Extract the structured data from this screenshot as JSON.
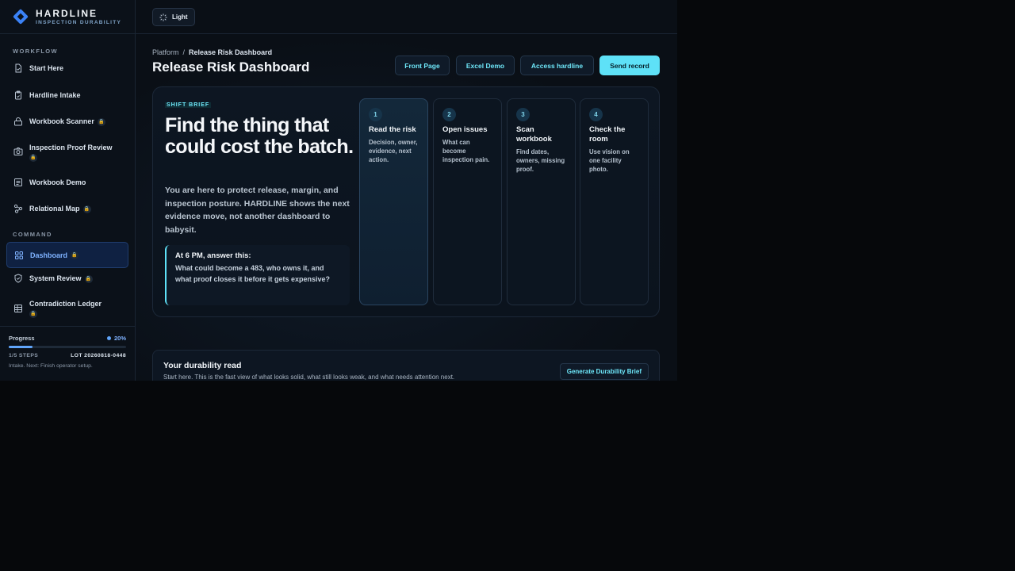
{
  "brand": {
    "name": "HARDLINE",
    "subtitle": "INSPECTION DURABILITY"
  },
  "sidebar": {
    "workflow_label": "WORKFLOW",
    "workflow": [
      {
        "label": "Start Here",
        "icon": "document-icon",
        "locked": false
      },
      {
        "label": "Hardline Intake",
        "icon": "clipboard-icon",
        "locked": false
      },
      {
        "label": "Workbook Scanner",
        "icon": "lock-scanner-icon",
        "locked": true
      },
      {
        "label": "Inspection Proof Review",
        "icon": "camera-icon",
        "locked": true
      },
      {
        "label": "Workbook Demo",
        "icon": "list-icon",
        "locked": false
      },
      {
        "label": "Relational Map",
        "icon": "map-icon",
        "locked": true
      }
    ],
    "command_label": "COMMAND",
    "command": [
      {
        "label": "Dashboard",
        "icon": "grid-icon",
        "locked": true,
        "active": true
      },
      {
        "label": "System Review",
        "icon": "shield-icon",
        "locked": true
      },
      {
        "label": "Contradiction Ledger",
        "icon": "table-icon",
        "locked": true
      }
    ],
    "lock_glyph": "🔒"
  },
  "progress": {
    "label": "Progress",
    "percent_text": "20%",
    "value": 0.2,
    "steps_text": "1/5 STEPS",
    "lot_text": "LOT 20260818-0448",
    "note": "Intake. Next: Finish operator setup."
  },
  "topbar": {
    "theme_label": "Light"
  },
  "breadcrumb": {
    "root": "Platform",
    "separator": "/",
    "current": "Release Risk Dashboard"
  },
  "page_title": "Release Risk Dashboard",
  "header_buttons": {
    "front_page": "Front Page",
    "excel_demo": "Excel Demo",
    "access": "Access hardline",
    "send": "Send record"
  },
  "brief": {
    "tag": "SHIFT BRIEF",
    "headline": "Find the thing that could cost the batch.",
    "lede": "You are here to protect release, margin, and inspection posture. HARDLINE shows the next evidence move, not another dashboard to babysit.",
    "callout_heading": "At 6 PM, answer this:",
    "callout_body": "What could become a 483, who owns it, and what proof closes it before it gets expensive?",
    "steps": [
      {
        "num": "1",
        "title": "Read the risk",
        "desc": "Decision, owner, evidence, next action."
      },
      {
        "num": "2",
        "title": "Open issues",
        "desc": "What can become inspection pain."
      },
      {
        "num": "3",
        "title": "Scan workbook",
        "desc": "Find dates, owners, missing proof."
      },
      {
        "num": "4",
        "title": "Check the room",
        "desc": "Use vision on one facility photo."
      }
    ]
  },
  "durability": {
    "title": "Your durability read",
    "subtitle": "Start here. This is the fast view of what looks solid, what still looks weak, and what needs attention next.",
    "button": "Generate Durability Brief"
  },
  "colors": {
    "accent": "#5ee1f7",
    "brand": "#3b82f6",
    "active_nav": "#7fb2ff",
    "background": "#06080b"
  }
}
